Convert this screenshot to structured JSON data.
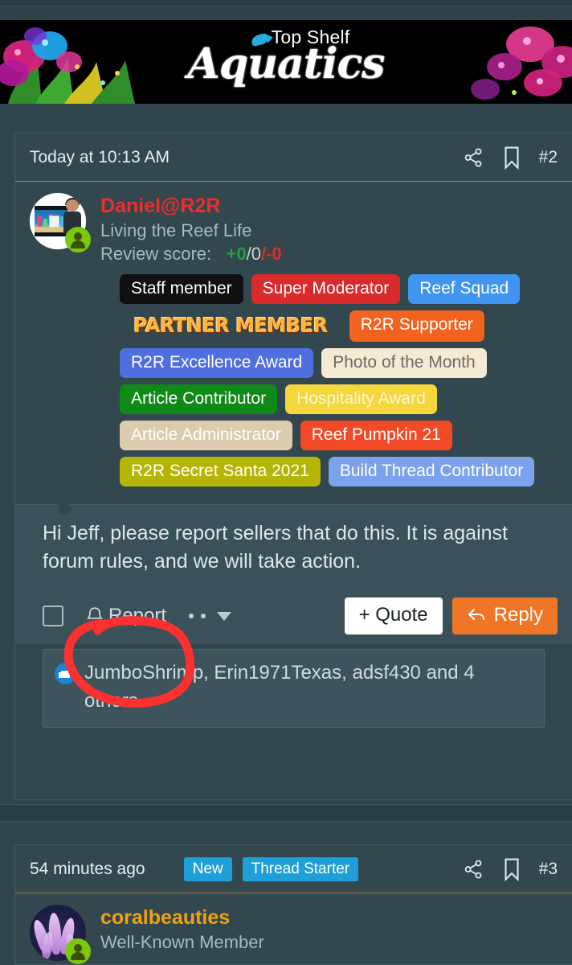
{
  "banner": {
    "name": "top-shelf-aquatics-banner",
    "brand_line1": "Top Shelf",
    "brand_line2": "Aquatics",
    "background": "#000000",
    "accent": "#29a8e0"
  },
  "colors": {
    "page_bg": "#31454d",
    "post_bg": "#33474f",
    "message_bg": "#3b515a",
    "accent_rule": "#b5703f",
    "username_red": "#ee2c2c",
    "username_gold": "#eda312",
    "reply_orange": "#ef7627",
    "annotation_red": "#fb3030",
    "chip_blue": "#1e9fd8",
    "online_green": "#7ac70c"
  },
  "posts": [
    {
      "id": "post-1",
      "date": "Today at 10:13 AM",
      "post_number": "#2",
      "chips": [],
      "share_icon": "share-icon",
      "bookmark_icon": "bookmark-icon",
      "user": {
        "name": "Daniel@R2R",
        "name_color": "#ee2c2c",
        "title": "Living the Reef Life",
        "review_label": "Review score:",
        "review_positive": "+0",
        "review_neutral": "/0",
        "review_negative": "/-0",
        "avatar_name": "avatar-daniel",
        "online": true
      },
      "badges": [
        {
          "label": "Staff member",
          "bg": "#101010",
          "fg": "#ffffff"
        },
        {
          "label": "Super Moderator",
          "bg": "#d92b2b",
          "fg": "#ffffff"
        },
        {
          "label": "Reef Squad",
          "bg": "#3f95f0",
          "fg": "#ffffff"
        },
        {
          "label": "PARTNER MEMBER",
          "bg": "#000000",
          "fg": "#ffb33a",
          "style": "partner"
        },
        {
          "label": "R2R Supporter",
          "bg": "#f2631f",
          "fg": "#ffffff"
        },
        {
          "label": "R2R Excellence Award",
          "bg": "#4f6fe0",
          "fg": "#ffffff"
        },
        {
          "label": "Photo of the Month",
          "bg": "#f7ead3",
          "fg": "#6d6a62"
        },
        {
          "label": "Article Contributor",
          "bg": "#0f8a16",
          "fg": "#ffffff"
        },
        {
          "label": "Hospitality Award",
          "bg": "#f5d63b",
          "fg": "#fbf6d8"
        },
        {
          "label": "Article Administrator",
          "bg": "#ddcbae",
          "fg": "#ffffff"
        },
        {
          "label": "Reef Pumpkin 21",
          "bg": "#f24a26",
          "fg": "#ffffff"
        },
        {
          "label": "R2R Secret Santa 2021",
          "bg": "#b5b508",
          "fg": "#ffffff"
        },
        {
          "label": "Build Thread Contributor",
          "bg": "#7da2ec",
          "fg": "#ffffff"
        }
      ],
      "message": "Hi Jeff, please report sellers that do this. It is against forum rules, and we will take action.",
      "actions": {
        "checkbox_checked": false,
        "report_label": "Report",
        "report_icon": "bell-icon",
        "more_icon": "ellipsis-icon",
        "caret_icon": "chevron-down-icon",
        "quote_label": "+ Quote",
        "reply_label": "Reply",
        "reply_icon": "reply-arrow-icon"
      },
      "reactions": {
        "icon": "thumbs-up-icon",
        "text": "JumboShrimp, Erin1971Texas, adsf430 and 4 others"
      }
    },
    {
      "id": "post-2",
      "date": "54 minutes ago",
      "post_number": "#3",
      "chips": [
        "New",
        "Thread Starter"
      ],
      "share_icon": "share-icon",
      "bookmark_icon": "bookmark-icon",
      "user": {
        "name": "coralbeauties",
        "name_color": "#eda312",
        "title": "Well-Known Member",
        "avatar_name": "avatar-coralbeauties",
        "online": true
      }
    }
  ],
  "annotation": {
    "name": "red-circle-annotation",
    "target": "Report",
    "color": "#fb3030"
  }
}
